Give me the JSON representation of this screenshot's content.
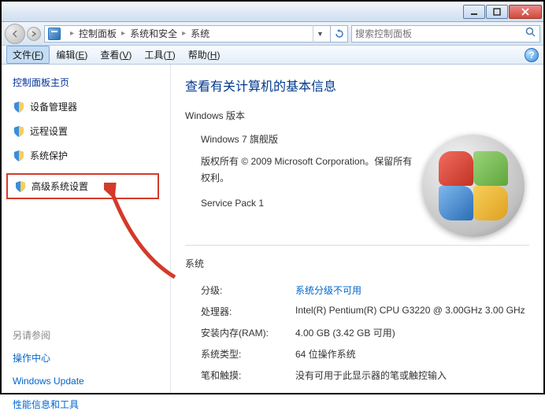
{
  "breadcrumb": {
    "i1": "控制面板",
    "i2": "系统和安全",
    "i3": "系统"
  },
  "search": {
    "placeholder": "搜索控制面板"
  },
  "menu": {
    "file": {
      "label": "文件",
      "hotkey": "F"
    },
    "edit": {
      "label": "编辑",
      "hotkey": "E"
    },
    "view": {
      "label": "查看",
      "hotkey": "V"
    },
    "tools": {
      "label": "工具",
      "hotkey": "T"
    },
    "help": {
      "label": "帮助",
      "hotkey": "H"
    }
  },
  "sidebar": {
    "home": "控制面板主页",
    "device_manager": "设备管理器",
    "remote_settings": "远程设置",
    "system_protection": "系统保护",
    "advanced_settings": "高级系统设置",
    "see_also_title": "另请参阅",
    "action_center": "操作中心",
    "windows_update": "Windows Update",
    "perf_tools": "性能信息和工具"
  },
  "content": {
    "title": "查看有关计算机的基本信息",
    "edition_title": "Windows 版本",
    "edition_name": "Windows 7 旗舰版",
    "copyright": "版权所有 © 2009 Microsoft Corporation。保留所有权利。",
    "service_pack": "Service Pack 1",
    "system_title": "系统",
    "rows": {
      "rating_label": "分级:",
      "rating_value": "系统分级不可用",
      "cpu_label": "处理器:",
      "cpu_value": "Intel(R) Pentium(R) CPU G3220 @ 3.00GHz 3.00 GHz",
      "ram_label": "安装内存(RAM):",
      "ram_value": "4.00 GB (3.42 GB 可用)",
      "type_label": "系统类型:",
      "type_value": "64 位操作系统",
      "pen_label": "笔和触摸:",
      "pen_value": "没有可用于此显示器的笔或触控输入"
    }
  }
}
